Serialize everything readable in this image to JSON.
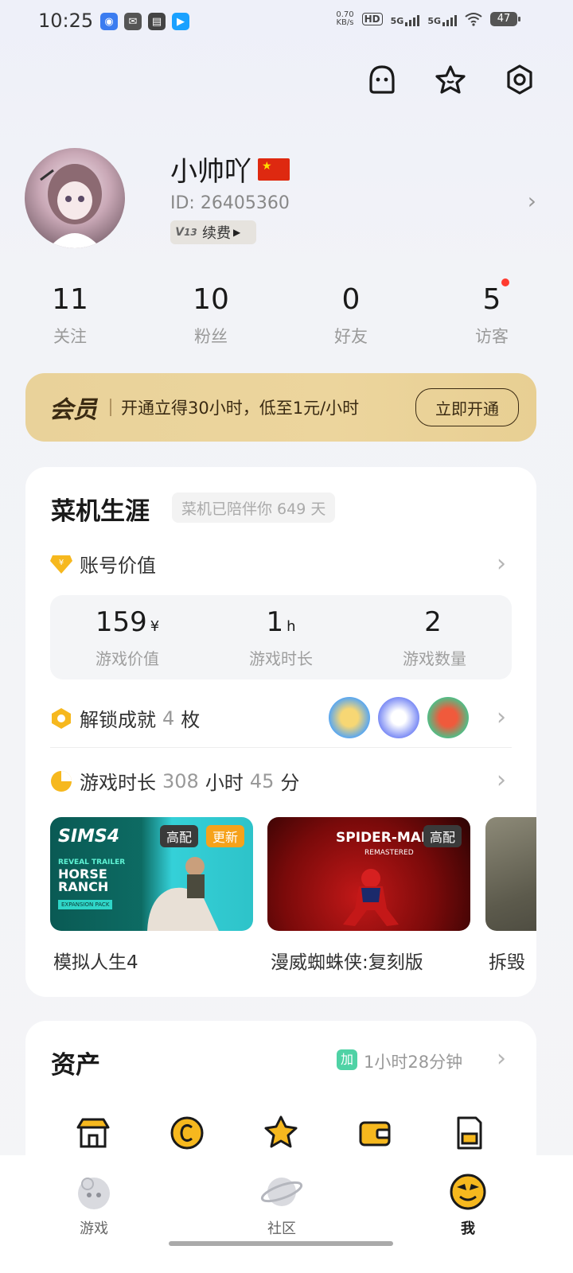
{
  "status_bar": {
    "time": "10:25",
    "speed_top": "0.70",
    "speed_bottom": "KB/s",
    "hd": "HD",
    "net1": "5G",
    "net2": "5G",
    "battery": "47"
  },
  "top_icons": [
    "ghost-icon",
    "star-icon",
    "settings-icon"
  ],
  "profile": {
    "username": "小帅吖",
    "id_label": "ID:",
    "id_value": "26405360",
    "vip_level": "13",
    "renew_label": "续费"
  },
  "stats": [
    {
      "num": "11",
      "label": "关注"
    },
    {
      "num": "10",
      "label": "粉丝"
    },
    {
      "num": "0",
      "label": "好友"
    },
    {
      "num": "5",
      "label": "访客"
    }
  ],
  "member": {
    "logo": "会员",
    "desc": "开通立得30小时，低至1元/小时",
    "button": "立即开通"
  },
  "career": {
    "title": "菜机生涯",
    "days_text": "菜机已陪伴你 649 天",
    "account_value_label": "账号价值",
    "values": [
      {
        "num": "159",
        "unit": "¥",
        "label": "游戏价值"
      },
      {
        "num": "1",
        "unit": "h",
        "label": "游戏时长"
      },
      {
        "num": "2",
        "unit": "",
        "label": "游戏数量"
      }
    ],
    "ach_prefix": "解锁成就",
    "ach_count": "4",
    "ach_suffix": "枚",
    "time_prefix": "游戏时长",
    "time_hours": "308",
    "time_h_unit": "小时",
    "time_minutes": "45",
    "time_m_unit": "分",
    "games": [
      {
        "name": "模拟人生4",
        "tags": [
          "高配",
          "更新"
        ],
        "cover_title": "SIMS4",
        "cover_sub": "REVEAL TRAILER",
        "cover_main": "HORSE RANCH",
        "cover_small": "EXPANSION PACK"
      },
      {
        "name": "漫威蜘蛛侠:复刻版",
        "tags": [
          "高配"
        ],
        "cover_title": "SPIDER-MAN",
        "cover_sub": "REMASTERED"
      },
      {
        "name": "拆毁",
        "tags": []
      }
    ]
  },
  "assets": {
    "title": "资产",
    "badge": "加",
    "time": "1小时28分钟"
  },
  "bottom_nav": [
    {
      "label": "游戏"
    },
    {
      "label": "社区"
    },
    {
      "label": "我"
    }
  ]
}
